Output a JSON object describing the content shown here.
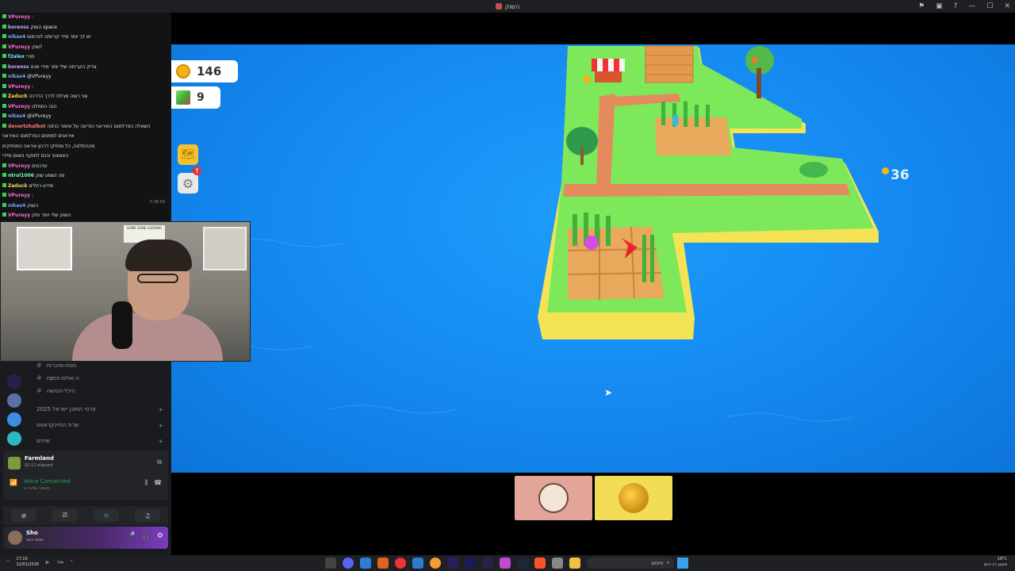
{
  "window": {
    "title": "השוק"
  },
  "chat": {
    "lines": [
      {
        "user": "VPureyy",
        "text": ":",
        "color": "#ff6ad5"
      },
      {
        "user": "korenss",
        "text": "השוק space",
        "color": "#c9a7ff"
      },
      {
        "user": "nikas4",
        "text": "יש לך יותר מידי קריותה לפרסום",
        "color": "#7aa7ff"
      },
      {
        "user": "VPureyy",
        "text": "שוק?",
        "color": "#ff6ad5"
      },
      {
        "user": "f2alex",
        "text": "מורי",
        "color": "#7ae6ff"
      },
      {
        "user": "korenss",
        "text": "צדיק הקריתה שלי יותר מידי מכונ",
        "color": "#c9a7ff"
      },
      {
        "user": "nikas4",
        "text": "@VPureyy",
        "color": "#7aa7ff"
      },
      {
        "user": "VPureyy",
        "text": ":",
        "color": "#ff6ad5"
      },
      {
        "user": "Zaduck",
        "text": "אני רוצה מגילת לדרך הדרכה",
        "color": "#ffd257"
      },
      {
        "user": "VPureyy",
        "text": "הנה התחלנו",
        "color": "#ff6ad5"
      },
      {
        "user": "nikas4",
        "text": "@VPureyy",
        "color": "#7aa7ff"
      },
      {
        "user": "dovertzhalbot",
        "text": "השאלה הפרלמנט האיראני הודיעה על איסור כניסה",
        "color": "#ff7a7a"
      },
      {
        "user": "",
        "text": "איראנים למתחם הפרלמנט האיראני",
        "color": "#ffffff"
      },
      {
        "user": "",
        "text": "מההחלטה, כל מחזיקי דרכון איראני המחזיקים",
        "color": "#ffffff"
      },
      {
        "user": "",
        "text": "האמצעי נכנס לתוקף באופן מיידי",
        "color": "#ffffff"
      },
      {
        "user": "VPureyy",
        "text": "עדכונים",
        "color": "#ff6ad5"
      },
      {
        "user": "ntrol1006",
        "text": "מה נשמע שוק",
        "color": "#7affb0"
      },
      {
        "user": "Zaduck",
        "text": "מידע-רחלים",
        "color": "#ffd257"
      },
      {
        "user": "VPureyy",
        "text": ":",
        "color": "#ff6ad5"
      },
      {
        "user": "nikas4",
        "text": "השוק",
        "color": "#7aa7ff"
      },
      {
        "user": "VPureyy",
        "text": "השוק שלי יותר חזק",
        "color": "#ff6ad5"
      }
    ],
    "time": "5:38:58"
  },
  "webcam": {
    "poster_text": "GAME ZONE LOADING"
  },
  "channels": [
    {
      "name": "חנות-מזכרות"
    },
    {
      "name": "npcs-ה-אולם"
    },
    {
      "name": "היכל-הבושה"
    }
  ],
  "categories": [
    {
      "name": "פרסי התוכן ישראל 2025"
    },
    {
      "name": "שרת המיינקראפט"
    },
    {
      "name": "שיחים"
    }
  ],
  "activity": {
    "name": "Farmland",
    "elapsed": "02:12 elapsed"
  },
  "voice": {
    "status": "Voice Connected",
    "channel": "השוק / מדבר ב"
  },
  "user": {
    "name": "Sho",
    "status": "שיחה כאב"
  },
  "game": {
    "coins": "146",
    "blocks": "9",
    "floating_reward": "36",
    "colors": {
      "water": "#1488f0",
      "grass": "#7de85a",
      "sand": "#f7e55a",
      "path": "#e08a5a",
      "soil": "#e9a95c"
    }
  },
  "taskbar": {
    "time": "17:19",
    "date": "12/01/2026",
    "search_placeholder": "חיפוש",
    "lang": "עבר",
    "weather": "18°C",
    "weather_desc": "מעונן רב היום"
  },
  "icons": [
    "map-icon",
    "gear-icon",
    "alert-icon",
    "coin-icon",
    "cube-icon",
    "mic-icon",
    "headphones-icon",
    "settings-icon"
  ]
}
